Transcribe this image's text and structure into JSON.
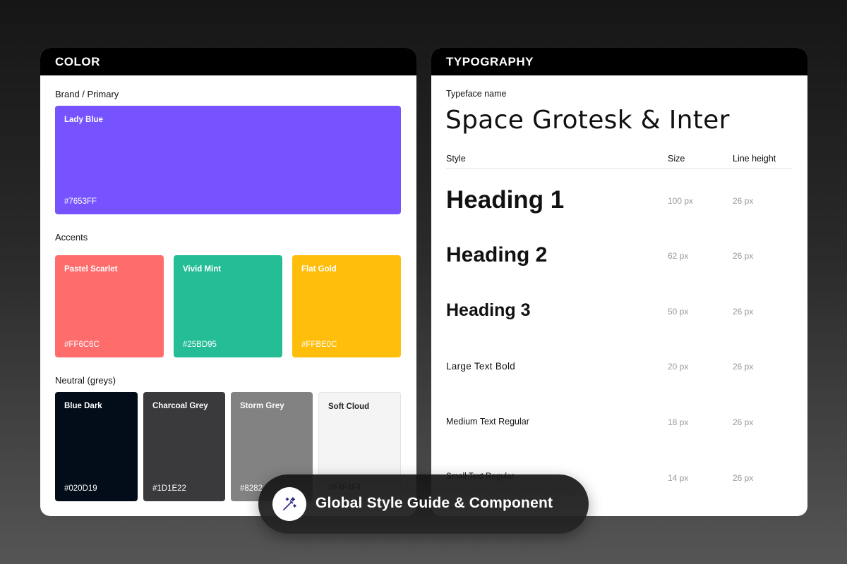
{
  "color_card": {
    "title": "COLOR",
    "brand_label": "Brand / Primary",
    "brand": {
      "name": "Lady Blue",
      "hex": "#7653FF"
    },
    "accents_label": "Accents",
    "accents": [
      {
        "name": "Pastel Scarlet",
        "hex": "#FF6C6C"
      },
      {
        "name": "Vivid Mint",
        "hex": "#25BD95"
      },
      {
        "name": "Flat Gold",
        "hex": "#FFBE0C"
      }
    ],
    "neutrals_label": "Neutral (greys)",
    "neutrals": [
      {
        "name": "Blue Dark",
        "hex": "#020D19"
      },
      {
        "name": "Charcoal Grey",
        "hex": "#1D1E22"
      },
      {
        "name": "Storm Grey",
        "hex": "#8282"
      },
      {
        "name": "Soft Cloud",
        "hex": "#F4F4F4"
      }
    ]
  },
  "typography_card": {
    "title": "TYPOGRAPHY",
    "typeface_label": "Typeface name",
    "typeface": "Space Grotesk & Inter",
    "columns": {
      "style": "Style",
      "size": "Size",
      "line_height": "Line height"
    },
    "rows": [
      {
        "style": "Heading 1",
        "size": "100 px",
        "line_height": "26 px"
      },
      {
        "style": "Heading 2",
        "size": "62 px",
        "line_height": "26 px"
      },
      {
        "style": "Heading 3",
        "size": "50 px",
        "line_height": "26 px"
      },
      {
        "style": "Large Text Bold",
        "size": "20 px",
        "line_height": "26 px"
      },
      {
        "style": "Medium Text Regular",
        "size": "18 px",
        "line_height": "26 px"
      },
      {
        "style": "Small Text Regular",
        "size": "14 px",
        "line_height": "26 px"
      }
    ]
  },
  "banner": {
    "icon": "magic-wand-icon",
    "text": "Global Style Guide & Component"
  }
}
